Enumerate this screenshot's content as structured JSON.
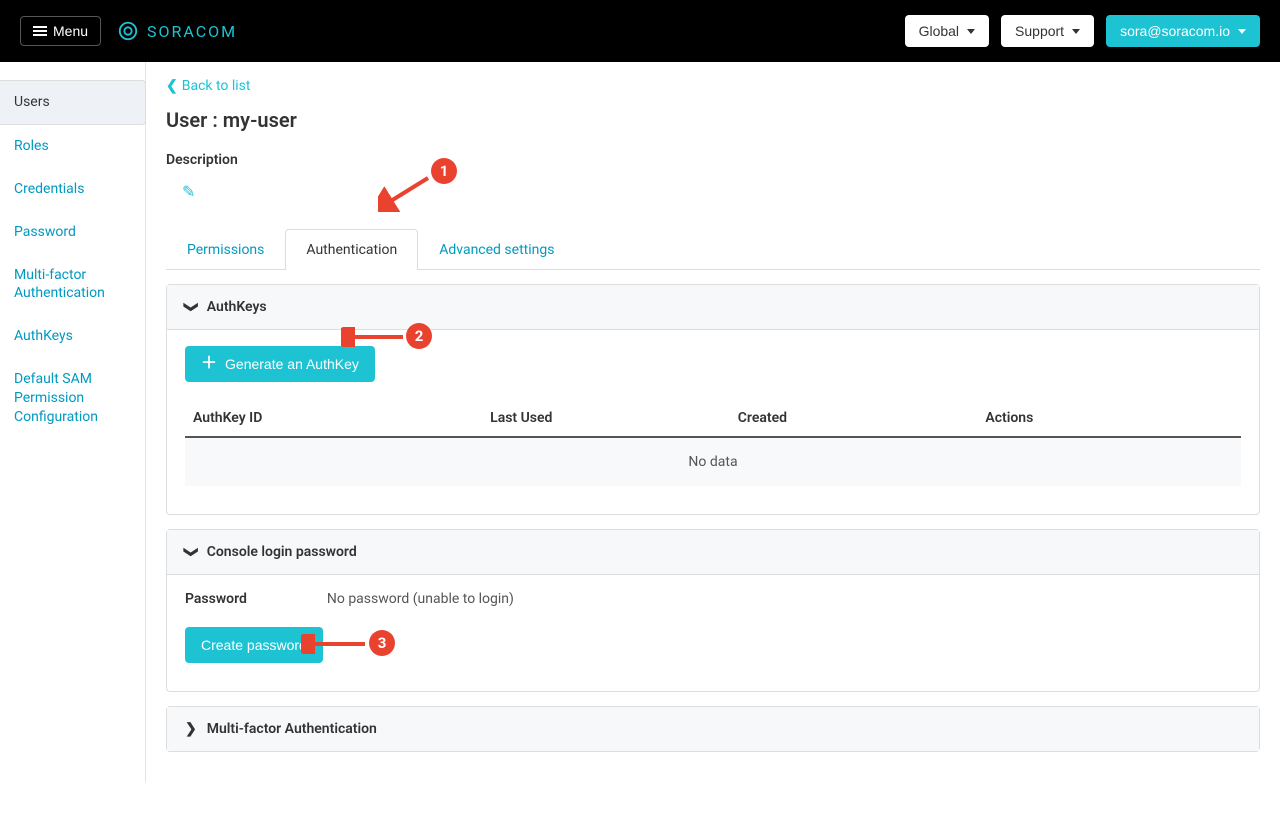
{
  "header": {
    "menu_label": "Menu",
    "brand": "SORACOM",
    "global_label": "Global",
    "support_label": "Support",
    "user_email": "sora@soracom.io"
  },
  "sidebar": {
    "items": [
      {
        "label": "Users",
        "active": true
      },
      {
        "label": "Roles"
      },
      {
        "label": "Credentials"
      },
      {
        "label": "Password"
      },
      {
        "label": "Multi-factor Authentication"
      },
      {
        "label": "AuthKeys"
      },
      {
        "label": "Default SAM Permission Configuration"
      }
    ]
  },
  "back_link": "Back to list",
  "page_title": "User : my-user",
  "description_label": "Description",
  "tabs": {
    "permissions": "Permissions",
    "authentication": "Authentication",
    "advanced": "Advanced settings"
  },
  "authkeys": {
    "panel_title": "AuthKeys",
    "generate_btn": "Generate an AuthKey",
    "col_id": "AuthKey ID",
    "col_last": "Last Used",
    "col_created": "Created",
    "col_actions": "Actions",
    "no_data": "No data"
  },
  "password": {
    "panel_title": "Console login password",
    "label": "Password",
    "value": "No password (unable to login)",
    "create_btn": "Create password"
  },
  "mfa": {
    "panel_title": "Multi-factor Authentication"
  },
  "annotations": {
    "b1": "1",
    "b2": "2",
    "b3": "3"
  }
}
